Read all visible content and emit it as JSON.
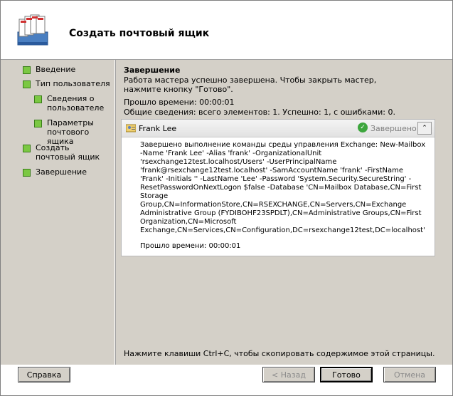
{
  "header": {
    "title": "Создать почтовый ящик"
  },
  "nav": {
    "items": [
      {
        "label": "Введение"
      },
      {
        "label": "Тип пользователя"
      },
      {
        "label": "Сведения о пользователе"
      },
      {
        "label": "Параметры почтового ящика"
      },
      {
        "label": "Создать почтовый ящик"
      },
      {
        "label": "Завершение"
      }
    ]
  },
  "main": {
    "section_title": "Завершение",
    "completion_text": "Работа мастера успешно завершена. Чтобы закрыть мастер, нажмите кнопку \"Готово\".",
    "elapsed": "Прошло времени: 00:00:01",
    "summary": "Общие сведения: всего элементов: 1. Успешно: 1, с ошибками: 0."
  },
  "task": {
    "name": "Frank Lee",
    "status": "Завершено",
    "command": "Завершено выполнение команды среды управления Exchange: New-Mailbox -Name 'Frank Lee' -Alias 'frank' -OrganizationalUnit 'rsexchange12test.localhost/Users' -UserPrincipalName 'frank@rsexchange12test.localhost' -SamAccountName 'frank' -FirstName 'Frank' -Initials '' -LastName 'Lee' -Password 'System.Security.SecureString' -ResetPasswordOnNextLogon $false -Database 'CN=Mailbox Database,CN=First Storage Group,CN=InformationStore,CN=RSEXCHANGE,CN=Servers,CN=Exchange Administrative Group (FYDIBOHF23SPDLT),CN=Administrative Groups,CN=First Organization,CN=Microsoft Exchange,CN=Services,CN=Configuration,DC=rsexchange12test,DC=localhost'",
    "elapsed": "Прошло времени: 00:00:01"
  },
  "footer": {
    "hint": "Нажмите клавиши Ctrl+C, чтобы скопировать содержимое этой страницы.",
    "help_label": "Справка",
    "back_label": "< Назад",
    "finish_label": "Готово",
    "cancel_label": "Отмена"
  }
}
